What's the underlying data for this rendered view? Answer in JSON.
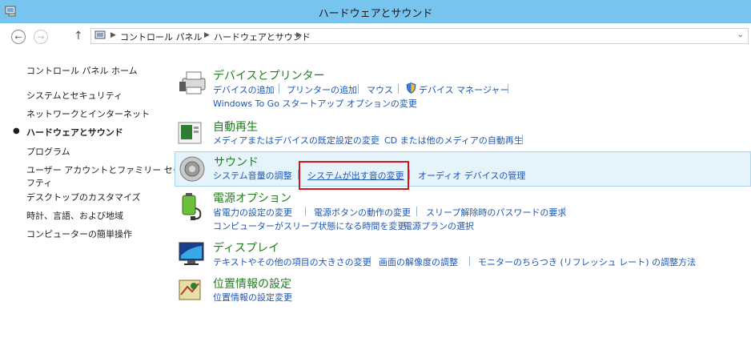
{
  "window": {
    "title": "ハードウェアとサウンド"
  },
  "nav": {
    "breadcrumbs": [
      "コントロール パネル",
      "ハードウェアとサウンド"
    ]
  },
  "sidebar": {
    "home": "コントロール パネル ホーム",
    "items": [
      "システムとセキュリティ",
      "ネットワークとインターネット",
      "ハードウェアとサウンド",
      "プログラム",
      "ユーザー アカウントとファミリー セー",
      "フティ",
      "デスクトップのカスタマイズ",
      "時計、言語、および地域",
      "コンピューターの簡単操作"
    ]
  },
  "categories": {
    "devices": {
      "title": "デバイスとプリンター",
      "links": [
        "デバイスの追加",
        "プリンターの追加",
        "マウス",
        "デバイス マネージャー"
      ],
      "links2": [
        "Windows To Go スタートアップ オプションの変更"
      ]
    },
    "autoplay": {
      "title": "自動再生",
      "links": [
        "メディアまたはデバイスの既定設定の変更",
        "CD または他のメディアの自動再生"
      ]
    },
    "sound": {
      "title": "サウンド",
      "links": [
        "システム音量の調整",
        "システムが出す音の変更",
        "オーディオ デバイスの管理"
      ]
    },
    "power": {
      "title": "電源オプション",
      "links": [
        "省電力の設定の変更",
        "電源ボタンの動作の変更",
        "スリープ解除時のパスワードの要求"
      ],
      "links2": [
        "コンピューターがスリープ状態になる時間を変更",
        "電源プランの選択"
      ]
    },
    "display": {
      "title": "ディスプレイ",
      "links": [
        "テキストやその他の項目の大きさの変更",
        "画面の解像度の調整",
        "モニターのちらつき (リフレッシュ レート) の調整方法"
      ]
    },
    "location": {
      "title": "位置情報の設定",
      "links": [
        "位置情報の設定変更"
      ]
    }
  }
}
